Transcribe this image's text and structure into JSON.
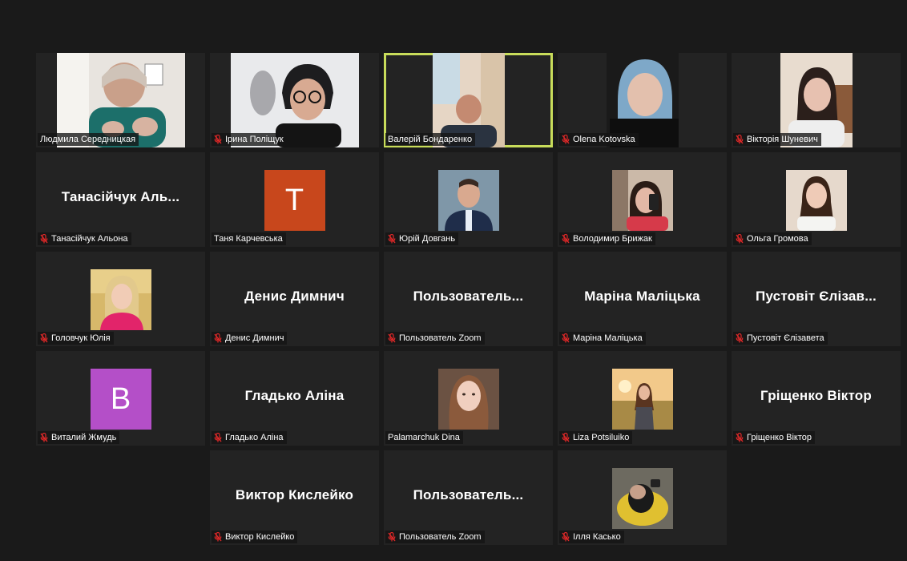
{
  "colors": {
    "background": "#1a1a1a",
    "tile": "#232323",
    "active_speaker_border": "#c8dc5a",
    "muted_icon": "#e02828"
  },
  "rows": [
    [
      {
        "name": "Людмила Середницкая",
        "muted": false,
        "kind": "video",
        "scene": "office-window",
        "active": false
      },
      {
        "name": "Ірина Поліщук",
        "muted": true,
        "kind": "video",
        "scene": "woman-glasses",
        "active": false
      },
      {
        "name": "Валерій Бондаренко",
        "muted": false,
        "kind": "video-narrow",
        "scene": "man-office",
        "active": true
      },
      {
        "name": "Olena Kotovska",
        "muted": true,
        "kind": "video-narrow",
        "scene": "hood-girl",
        "active": false
      },
      {
        "name": "Вікторія Шуневич",
        "muted": true,
        "kind": "video-narrow",
        "scene": "girl-room",
        "active": false
      }
    ],
    [
      {
        "name": "Танасійчук Альона",
        "muted": true,
        "kind": "text",
        "display": "Танасійчук  Аль..."
      },
      {
        "name": "Таня Карчевська",
        "muted": false,
        "kind": "letter",
        "letter": "T",
        "letter_color": "#c8471c"
      },
      {
        "name": "Юрій Довгань",
        "muted": true,
        "kind": "photo",
        "scene": "man-suit"
      },
      {
        "name": "Володимир Брижак",
        "muted": true,
        "kind": "photo",
        "scene": "selfie-mirror"
      },
      {
        "name": "Ольга Громова",
        "muted": true,
        "kind": "photo",
        "scene": "girl-long-hair"
      }
    ],
    [
      {
        "name": "Головчук Юлія",
        "muted": true,
        "kind": "photo",
        "scene": "blonde-pink"
      },
      {
        "name": "Денис Димнич",
        "muted": true,
        "kind": "text",
        "display": "Денис Димнич"
      },
      {
        "name": "Пользователь Zoom",
        "muted": true,
        "kind": "text",
        "display": "Пользователь..."
      },
      {
        "name": "Маріна Маліцька",
        "muted": true,
        "kind": "text",
        "display": "Маріна Маліцька"
      },
      {
        "name": "Пустовіт Єлізавета",
        "muted": true,
        "kind": "text",
        "display": "Пустовіт Єлізав..."
      }
    ],
    [
      {
        "name": "Виталий Жмудь",
        "muted": true,
        "kind": "letter",
        "letter": "B",
        "letter_color": "#b44fc8"
      },
      {
        "name": "Гладько Аліна",
        "muted": true,
        "kind": "text",
        "display": "Гладько Аліна"
      },
      {
        "name": "Palamarchuk Dina",
        "muted": false,
        "kind": "photo",
        "scene": "girl-portrait"
      },
      {
        "name": "Liza Potsiluiko",
        "muted": true,
        "kind": "photo",
        "scene": "field-sunset"
      },
      {
        "name": "Гріщенко Віктор",
        "muted": true,
        "kind": "text",
        "display": "Гріщенко Віктор"
      }
    ],
    [
      {
        "name": "Виктор Кислейко",
        "muted": true,
        "kind": "text",
        "display": "Виктор Кислейко"
      },
      {
        "name": "Пользователь Zoom",
        "muted": true,
        "kind": "text",
        "display": "Пользователь..."
      },
      {
        "name": "Ілля Касько",
        "muted": true,
        "kind": "photo",
        "scene": "yellow-chair"
      }
    ]
  ]
}
